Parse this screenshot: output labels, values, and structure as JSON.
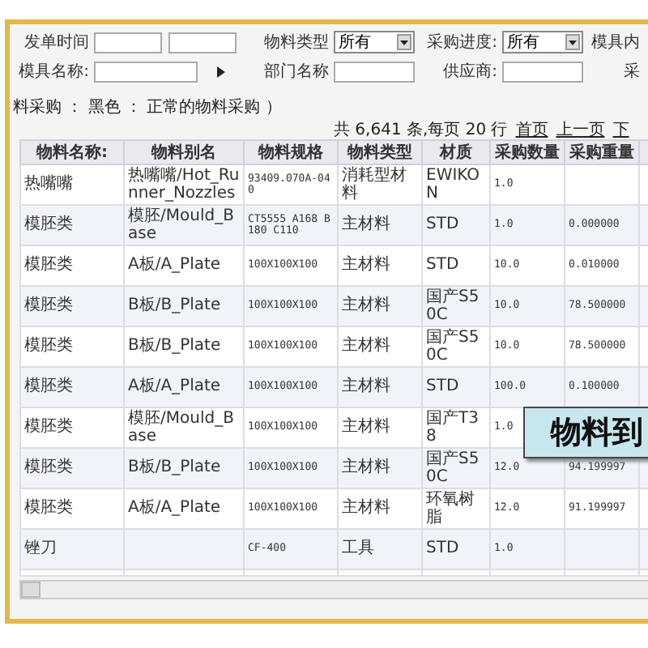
{
  "filters": [
    {
      "label": "发单时间",
      "kind": "daterange"
    },
    {
      "label": "物料类型",
      "kind": "select",
      "value": "所有"
    },
    {
      "label": "采购进度:",
      "kind": "select",
      "value": "所有"
    },
    {
      "label": "模具内",
      "kind": "cut"
    },
    {
      "label": "模具名称:",
      "kind": "picker"
    },
    {
      "label": "部门名称",
      "kind": "input"
    },
    {
      "label": "供应商:",
      "kind": "input"
    },
    {
      "label": "采",
      "kind": "cut"
    }
  ],
  "legend": "料采购 ： 黑色 ： 正常的物料采购 ）",
  "pager": {
    "summary": "共 6,641 条,每页 20 行",
    "links": [
      "首页",
      "上一页",
      "下"
    ]
  },
  "table": {
    "columns": [
      "物料名称:",
      "物料别名",
      "物料规格",
      "物料类型",
      "材质",
      "采购数量",
      "采购重量"
    ],
    "rows": [
      [
        "热嘴嘴",
        "热嘴嘴/Hot_Runner_Nozzles",
        "93409.070A-040",
        "消耗型材料",
        "EWIKON",
        "1.0",
        ""
      ],
      [
        "模胚类",
        "模胚/Mould_Base",
        "CT5555 A168 B180 C110",
        "主材料",
        "STD",
        "1.0",
        "0.000000"
      ],
      [
        "模胚类",
        "A板/A_Plate",
        "100X100X100",
        "主材料",
        "STD",
        "10.0",
        "0.010000"
      ],
      [
        "模胚类",
        "B板/B_Plate",
        "100X100X100",
        "主材料",
        "国产S50C",
        "10.0",
        "78.500000"
      ],
      [
        "模胚类",
        "B板/B_Plate",
        "100X100X100",
        "主材料",
        "国产S50C",
        "10.0",
        "78.500000"
      ],
      [
        "模胚类",
        "A板/A_Plate",
        "100X100X100",
        "主材料",
        "STD",
        "100.0",
        "0.100000"
      ],
      [
        "模胚类",
        "模胚/Mould_Base",
        "100X100X100",
        "主材料",
        "国产T38",
        "1.0",
        ""
      ],
      [
        "模胚类",
        "B板/B_Plate",
        "100X100X100",
        "主材料",
        "国产S50C",
        "12.0",
        "94.199997"
      ],
      [
        "模胚类",
        "A板/A_Plate",
        "100X100X100",
        "主材料",
        "环氧树脂",
        "12.0",
        "91.199997"
      ],
      [
        "锉刀",
        "",
        "CF-400",
        "工具",
        "STD",
        "1.0",
        ""
      ]
    ]
  },
  "callout": "物料到"
}
